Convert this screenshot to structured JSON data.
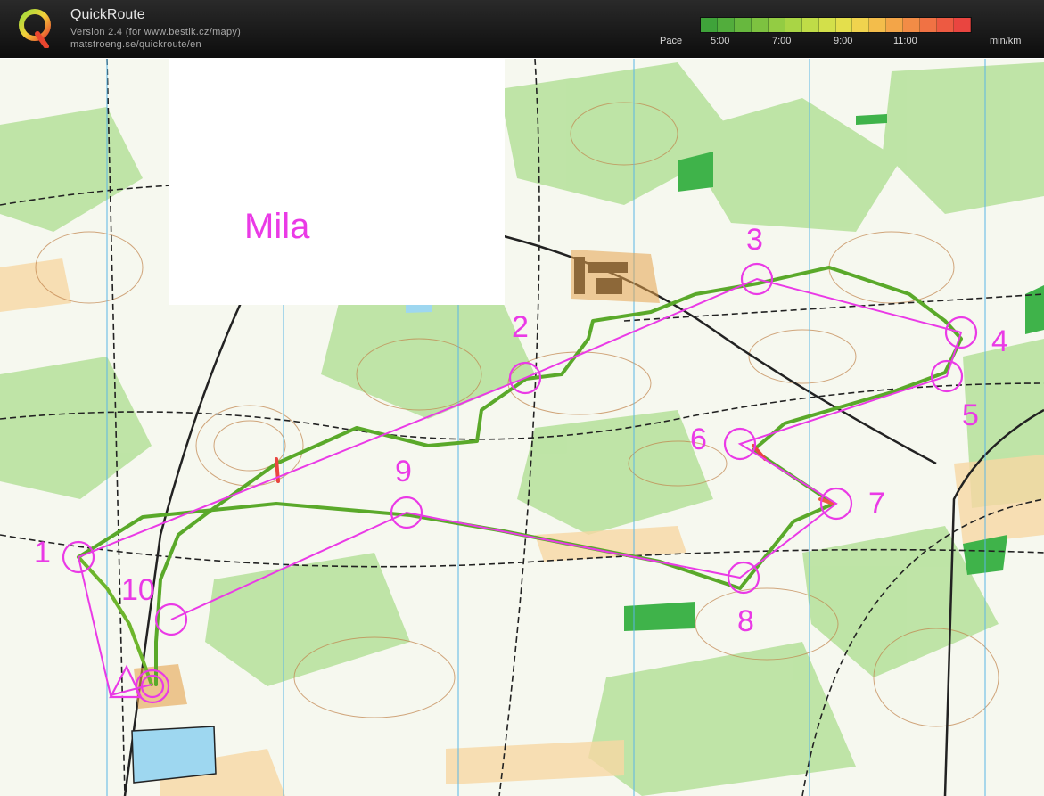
{
  "header": {
    "title": "QuickRoute",
    "version": "Version 2.4  (for www.bestik.cz/mapy)",
    "url": "matstroeng.se/quickroute/en"
  },
  "pace_scale": {
    "label": "Pace",
    "ticks": [
      "5:00",
      "7:00",
      "9:00",
      "11:00"
    ],
    "unit": "min/km",
    "colors": [
      "#3fa33a",
      "#52ad3c",
      "#67b83e",
      "#7dc240",
      "#93cc43",
      "#a9d545",
      "#bfdc47",
      "#d3e04a",
      "#e4df4c",
      "#f0d34e",
      "#f3bd4b",
      "#f3a548",
      "#f28c46",
      "#f07244",
      "#ed5a42",
      "#e94540"
    ]
  },
  "map": {
    "title": "Mila",
    "course_color": "#ea3ae6",
    "controls": [
      "1",
      "2",
      "3",
      "4",
      "5",
      "6",
      "7",
      "8",
      "9",
      "10"
    ]
  }
}
